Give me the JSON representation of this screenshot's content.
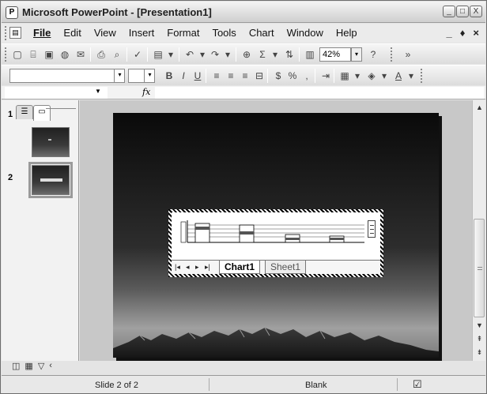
{
  "window": {
    "title": "Microsoft PowerPoint - [Presentation1]",
    "controls": [
      "_",
      "□",
      "X"
    ]
  },
  "menubar": {
    "items": [
      {
        "label": "File"
      },
      {
        "label": "Edit"
      },
      {
        "label": "View"
      },
      {
        "label": "Insert"
      },
      {
        "label": "Format"
      },
      {
        "label": "Tools"
      },
      {
        "label": "Chart"
      },
      {
        "label": "Window"
      },
      {
        "label": "Help"
      }
    ],
    "right_controls": [
      "_",
      "♦",
      "×"
    ]
  },
  "toolbar": {
    "zoom": "42%"
  },
  "formulabar": {
    "fx_label": "fx"
  },
  "slides": [
    {
      "number": "1",
      "selected": false
    },
    {
      "number": "2",
      "selected": true
    }
  ],
  "embedded_chart": {
    "tabs": [
      {
        "label": "Chart1",
        "active": true
      },
      {
        "label": "Sheet1",
        "active": false
      }
    ]
  },
  "statusbar": {
    "slide_info": "Slide 2 of 2",
    "design": "Blank"
  }
}
